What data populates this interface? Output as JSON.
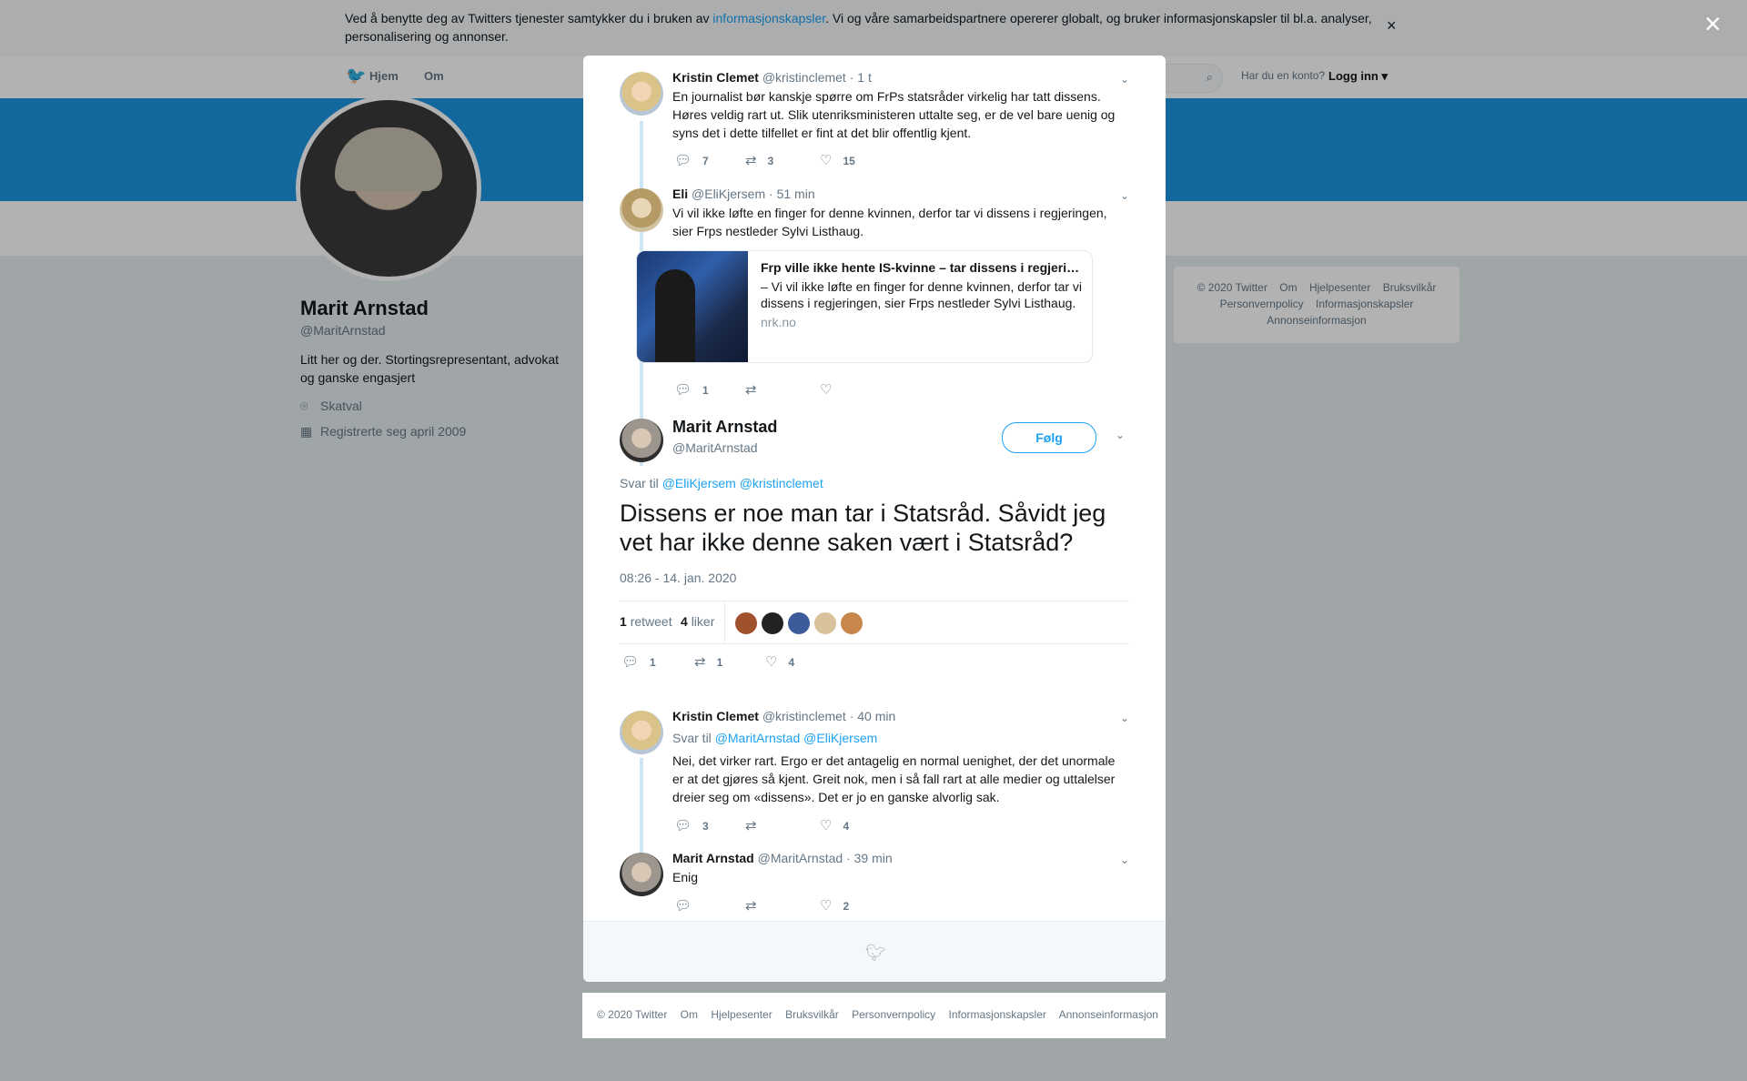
{
  "cookie": {
    "text_before": "Ved å benytte deg av Twitters tjenester samtykker du i bruken av ",
    "link": "informasjonskapsler",
    "text_after": ". Vi og våre samarbeidspartnere opererer globalt, og bruker informasjonskapsler til bl.a. analyser, personalisering og annonser.",
    "close": "×"
  },
  "nav": {
    "home": "Hjem",
    "about": "Om",
    "has_account": "Har du en konto?",
    "login": "Logg inn"
  },
  "profile": {
    "name": "Marit Arnstad",
    "handle": "@MaritArnstad",
    "bio": "Litt her og der. Stortingsrepresentant, advokat og ganske engasjert",
    "location": "Skatval",
    "joined": "Registrerte seg april 2009"
  },
  "sidebar_footer": {
    "links": [
      "© 2020 Twitter",
      "Om",
      "Hjelpesenter",
      "Bruksvilkår",
      "Personvernpolicy",
      "Informasjonskapsler",
      "Annonseinformasjon"
    ]
  },
  "overlay_close": "×",
  "modal": {
    "tweets": [
      {
        "name": "Kristin Clemet",
        "handle": "@kristinclemet",
        "time": "· 1 t",
        "text": "En journalist bør kanskje spørre om FrPs statsråder virkelig har tatt dissens. Høres veldig rart ut. Slik utenriksministeren uttalte seg, er de vel bare uenig og syns det i dette tilfellet er fint at det blir offentlig kjent.",
        "replies": "7",
        "retweets": "3",
        "likes": "15"
      },
      {
        "name": "Eli",
        "handle": "@EliKjersem",
        "time": "· 51 min",
        "text": "Vi vil ikke løfte en finger for denne kvinnen, derfor tar vi dissens i regjeringen, sier Frps nestleder Sylvi Listhaug.",
        "card": {
          "title": "Frp ville ikke hente IS-kvinne – tar dissens i regjeringen",
          "desc": "– Vi vil ikke løfte en finger for denne kvinnen, derfor tar vi dissens i regjeringen, sier Frps nestleder Sylvi Listhaug.",
          "domain": "nrk.no"
        },
        "replies": "1",
        "retweets": "",
        "likes": ""
      }
    ],
    "main": {
      "name": "Marit Arnstad",
      "handle": "@MaritArnstad",
      "follow": "Følg",
      "reply_to_label": "Svar til",
      "reply_to_1": "@EliKjersem",
      "reply_to_2": "@kristinclemet",
      "text": "Dissens er noe man tar i Statsråd. Såvidt jeg vet har ikke denne saken vært i Statsråd?",
      "timestamp": "08:26 - 14. jan. 2020",
      "retweet_count": "1",
      "retweet_label": "retweet",
      "like_count": "4",
      "like_label": "liker",
      "replies": "1",
      "retweets": "1",
      "likes": "4"
    },
    "replies": [
      {
        "name": "Kristin Clemet",
        "handle": "@kristinclemet",
        "time": "· 40 min",
        "reply_to_label": "Svar til",
        "reply_to_1": "@MaritArnstad",
        "reply_to_2": "@EliKjersem",
        "text": "Nei, det virker rart. Ergo er det antagelig en normal uenighet, der det unormale er at det gjøres så kjent. Greit nok, men i så fall rart at alle medier og uttalelser dreier seg om «dissens». Det er jo en ganske alvorlig sak.",
        "replies": "3",
        "retweets": "",
        "likes": "4"
      },
      {
        "name": "Marit Arnstad",
        "handle": "@MaritArnstad",
        "time": "· 39 min",
        "text": "Enig",
        "replies": "",
        "retweets": "",
        "likes": "2"
      }
    ]
  },
  "footer": {
    "links": [
      "© 2020 Twitter",
      "Om",
      "Hjelpesenter",
      "Bruksvilkår",
      "Personvernpolicy",
      "Informasjonskapsler",
      "Annonseinformasjon"
    ]
  },
  "colors": {
    "accent": "#1da1f2",
    "banner": "#1b95e0"
  }
}
